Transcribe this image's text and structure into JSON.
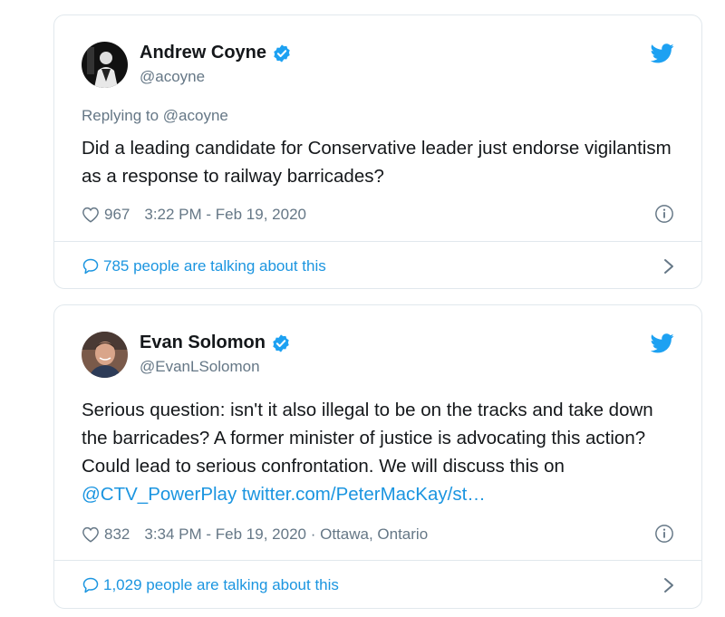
{
  "tweets": [
    {
      "author": {
        "name": "Andrew Coyne",
        "handle": "@acoyne",
        "avatar_icon": "avatar-bw-photo"
      },
      "replying_prefix": "Replying to",
      "replying_to": "@acoyne",
      "text": "Did a leading candidate for Conservative leader just endorse vigilantism as a response to railway barricades?",
      "likes": "967",
      "timestamp": "3:22 PM - Feb 19, 2020",
      "location": "",
      "talking": "785 people are talking about this"
    },
    {
      "author": {
        "name": "Evan Solomon",
        "handle": "@EvanLSolomon",
        "avatar_icon": "avatar-color-photo"
      },
      "text_plain": "Serious question: isn't it also illegal to be on the tracks and take down the barricades? A former minister of justice is advocating this action? Could lead to serious confrontation. We will discuss this on ",
      "text_mention": "@CTV_PowerPlay",
      "text_link": "twitter.com/PeterMacKay/st…",
      "likes": "832",
      "timestamp": "3:34 PM - Feb 19, 2020",
      "location_sep": " · ",
      "location": "Ottawa, Ontario",
      "talking": "1,029 people are talking about this"
    }
  ],
  "colors": {
    "twitter_blue": "#1da1f2",
    "link_blue": "#1b95e0",
    "text": "#14171a",
    "muted": "#657786",
    "border": "#e1e8ed"
  }
}
